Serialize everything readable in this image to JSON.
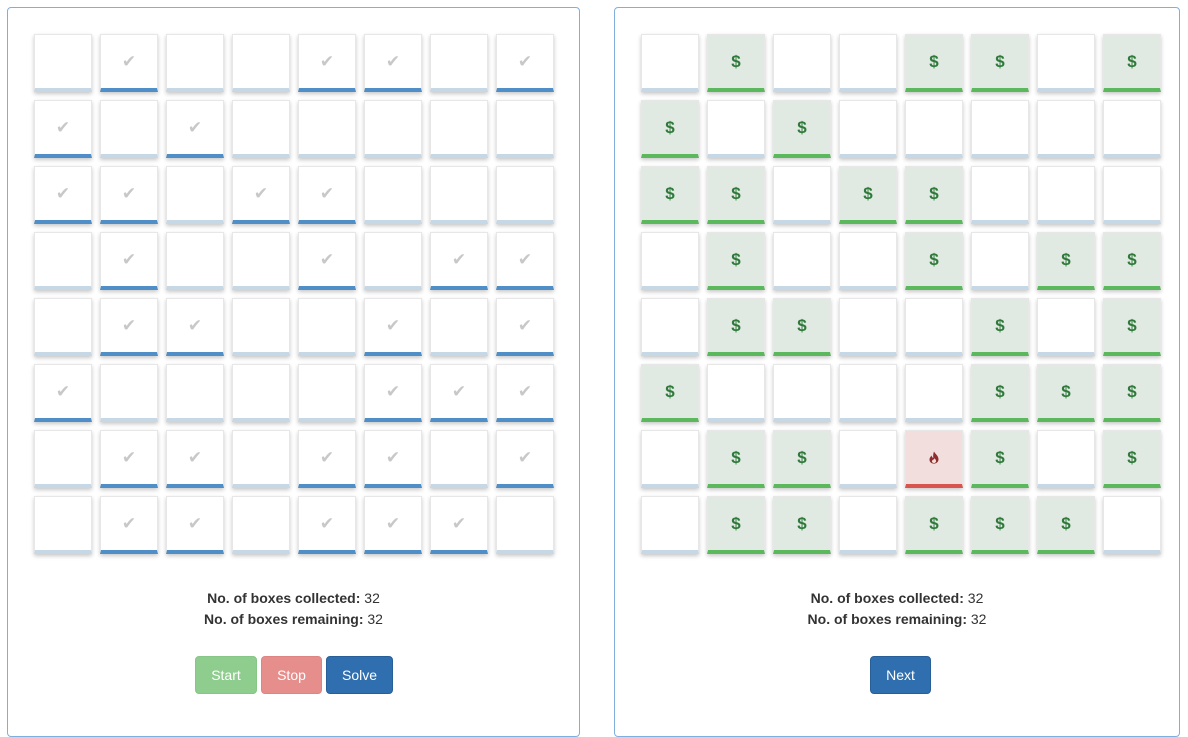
{
  "left": {
    "grid": [
      [
        0,
        1,
        0,
        0,
        1,
        1,
        0,
        1
      ],
      [
        1,
        0,
        1,
        0,
        0,
        0,
        0,
        0
      ],
      [
        1,
        1,
        0,
        1,
        1,
        0,
        0,
        0
      ],
      [
        0,
        1,
        0,
        0,
        1,
        0,
        1,
        1
      ],
      [
        0,
        1,
        1,
        0,
        0,
        1,
        0,
        1
      ],
      [
        1,
        0,
        0,
        0,
        0,
        1,
        1,
        1
      ],
      [
        0,
        1,
        1,
        0,
        1,
        1,
        0,
        1
      ],
      [
        0,
        1,
        1,
        0,
        1,
        1,
        1,
        0
      ]
    ],
    "stats": {
      "collected_label": "No. of boxes collected:",
      "collected_value": "32",
      "remaining_label": "No. of boxes remaining:",
      "remaining_value": "32"
    },
    "buttons": {
      "start": "Start",
      "stop": "Stop",
      "solve": "Solve"
    }
  },
  "right": {
    "grid": [
      [
        0,
        1,
        0,
        0,
        1,
        1,
        0,
        1
      ],
      [
        1,
        0,
        1,
        0,
        0,
        0,
        0,
        0
      ],
      [
        1,
        1,
        0,
        1,
        1,
        0,
        0,
        0
      ],
      [
        0,
        1,
        0,
        0,
        1,
        0,
        1,
        1
      ],
      [
        0,
        1,
        1,
        0,
        0,
        1,
        0,
        1
      ],
      [
        1,
        0,
        0,
        0,
        0,
        1,
        1,
        1
      ],
      [
        0,
        1,
        1,
        0,
        2,
        1,
        0,
        1
      ],
      [
        0,
        1,
        1,
        0,
        1,
        1,
        1,
        0
      ]
    ],
    "money_symbol": "$",
    "stats": {
      "collected_label": "No. of boxes collected:",
      "collected_value": "32",
      "remaining_label": "No. of boxes remaining:",
      "remaining_value": "32"
    },
    "buttons": {
      "next": "Next"
    }
  },
  "icons": {
    "collected": "checkmark-icon",
    "money": "dollar-icon",
    "hazard": "fire-icon"
  },
  "colors": {
    "collected_bar": "#4f8ec6",
    "empty_bar": "#c6d7e6",
    "money_bar": "#5cb85c",
    "money_bg": "#e0e9e2",
    "fire_bar": "#d9534f",
    "fire_bg": "#f1dedd"
  }
}
